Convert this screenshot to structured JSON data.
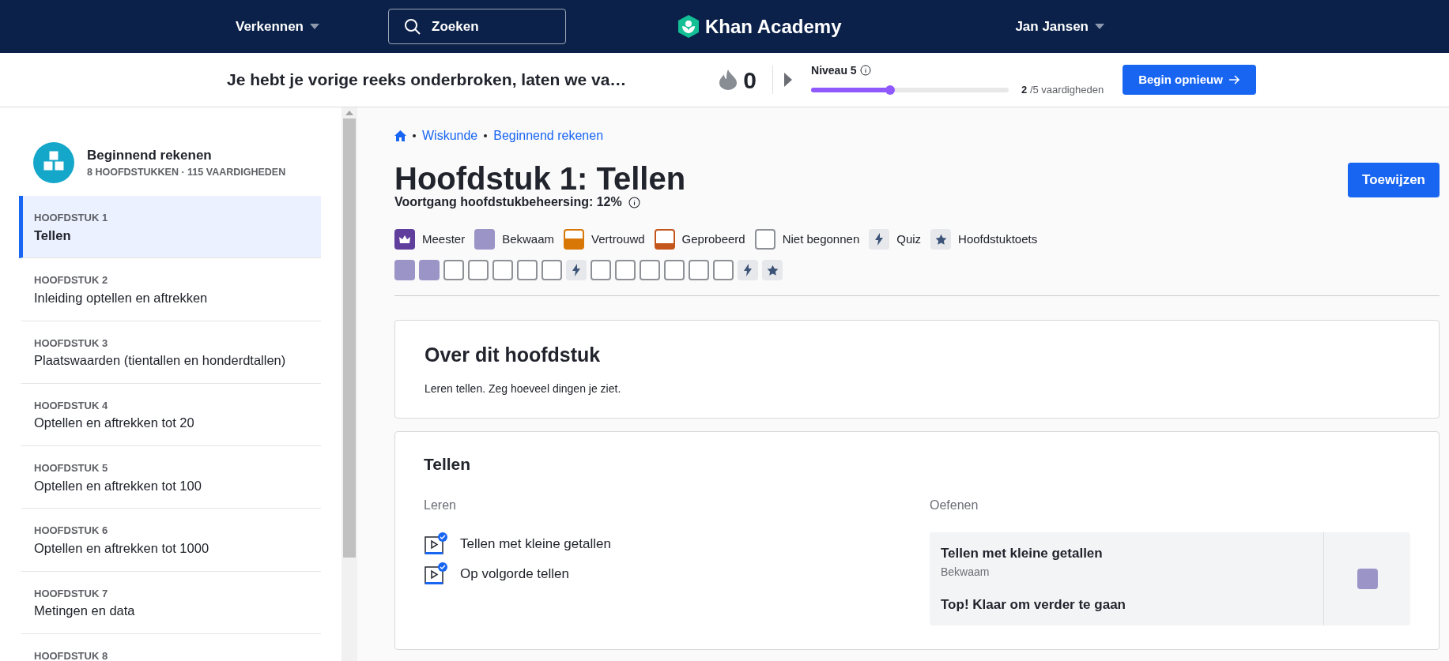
{
  "nav": {
    "explore": "Verkennen",
    "search_placeholder": "Zoeken",
    "logo": "Khan Academy",
    "user": "Jan Jansen"
  },
  "streak_bar": {
    "message": "Je hebt je vorige reeks onderbroken, laten we va…",
    "streak": "0",
    "level_label": "Niveau 5",
    "level": 0.4,
    "skills_done": "2",
    "skills_total": "/5 vaardigheden",
    "restart_button": "Begin opnieuw"
  },
  "sidebar": {
    "course_title": "Beginnend rekenen",
    "course_meta": "8 HOOFDSTUKKEN · 115 VAARDIGHEDEN",
    "units": [
      {
        "label": "HOOFDSTUK 1",
        "title": "Tellen",
        "selected": true
      },
      {
        "label": "HOOFDSTUK 2",
        "title": "Inleiding optellen en aftrekken",
        "selected": false
      },
      {
        "label": "HOOFDSTUK 3",
        "title": "Plaatswaarden (tientallen en honderdtallen)",
        "selected": false
      },
      {
        "label": "HOOFDSTUK 4",
        "title": "Optellen en aftrekken tot 20",
        "selected": false
      },
      {
        "label": "HOOFDSTUK 5",
        "title": "Optellen en aftrekken tot 100",
        "selected": false
      },
      {
        "label": "HOOFDSTUK 6",
        "title": "Optellen en aftrekken tot 1000",
        "selected": false
      },
      {
        "label": "HOOFDSTUK 7",
        "title": "Metingen en data",
        "selected": false
      },
      {
        "label": "HOOFDSTUK 8",
        "selected": false
      }
    ]
  },
  "breadcrumbs": [
    "Wiskunde",
    "Beginnend rekenen"
  ],
  "title": "Hoofdstuk 1: Tellen",
  "assign_button": "Toewijzen",
  "progress_text": "Voortgang hoofdstukbeheersing: 12%",
  "legend": [
    {
      "kind": "master",
      "label": "Meester"
    },
    {
      "kind": "proficient",
      "label": "Bekwaam"
    },
    {
      "kind": "familiar",
      "label": "Vertrouwd"
    },
    {
      "kind": "attempted",
      "label": "Geprobeerd"
    },
    {
      "kind": "not_started",
      "label": "Niet begonnen"
    },
    {
      "kind": "quiz",
      "label": "Quiz"
    },
    {
      "kind": "unit_test",
      "label": "Hoofdstuktoets"
    }
  ],
  "skill_squares": [
    {
      "kind": "proficient"
    },
    {
      "kind": "proficient"
    },
    {
      "kind": "not_started"
    },
    {
      "kind": "not_started"
    },
    {
      "kind": "not_started"
    },
    {
      "kind": "not_started"
    },
    {
      "kind": "not_started"
    },
    {
      "kind": "quiz"
    },
    {
      "kind": "not_started"
    },
    {
      "kind": "not_started"
    },
    {
      "kind": "not_started"
    },
    {
      "kind": "not_started"
    },
    {
      "kind": "not_started"
    },
    {
      "kind": "not_started"
    },
    {
      "kind": "quiz"
    },
    {
      "kind": "unit_test"
    }
  ],
  "about": {
    "heading": "Over dit hoofdstuk",
    "text": "Leren tellen. Zeg hoeveel dingen je ziet."
  },
  "lesson": {
    "heading": "Tellen",
    "learn_label": "Leren",
    "practice_label": "Oefenen",
    "videos": [
      {
        "title": "Tellen met kleine getallen",
        "completed": true
      },
      {
        "title": "Op volgorde tellen",
        "completed": true
      }
    ],
    "exercise": {
      "title": "Tellen met kleine getallen",
      "status": "Bekwaam",
      "kind": "proficient",
      "message": "Top! Klaar om verder te gaan"
    }
  }
}
